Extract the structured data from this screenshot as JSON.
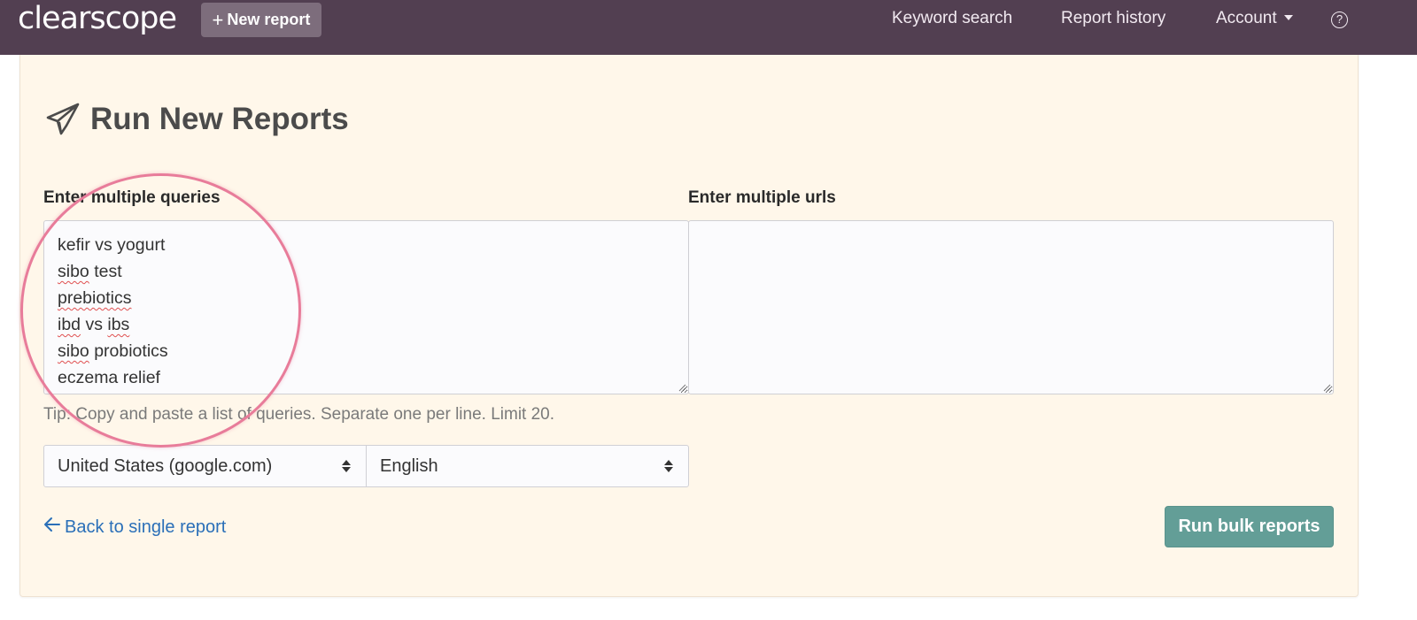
{
  "navbar": {
    "logo": "clearscope",
    "new_report_label": "New report",
    "links": {
      "keyword_search": "Keyword search",
      "report_history": "Report history",
      "account": "Account",
      "help_glyph": "?"
    }
  },
  "main": {
    "title": "Run New Reports",
    "title_icon": "paper-plane-icon",
    "queries_label": "Enter multiple queries",
    "urls_label": "Enter multiple urls",
    "queries": [
      {
        "words": [
          {
            "t": "kefir vs yogurt",
            "spell": false
          }
        ]
      },
      {
        "words": [
          {
            "t": "sibo",
            "spell": true
          },
          {
            "t": " test",
            "spell": false
          }
        ]
      },
      {
        "words": [
          {
            "t": "prebiotics",
            "spell": true
          }
        ]
      },
      {
        "words": [
          {
            "t": "ibd",
            "spell": true
          },
          {
            "t": " vs ",
            "spell": false
          },
          {
            "t": "ibs",
            "spell": true
          }
        ]
      },
      {
        "words": [
          {
            "t": "sibo",
            "spell": true
          },
          {
            "t": " probiotics",
            "spell": false
          }
        ]
      },
      {
        "words": [
          {
            "t": "eczema relief",
            "spell": false
          }
        ]
      }
    ],
    "urls_value": "",
    "tip": "Tip: Copy and paste a list of queries. Separate one per line. Limit 20.",
    "country_select": "United States (google.com)",
    "language_select": "English",
    "back_link": "Back to single report",
    "run_button": "Run bulk reports"
  },
  "colors": {
    "navbar_bg": "#523f51",
    "panel_bg": "#fff7ea",
    "primary_button": "#639e97",
    "link": "#2a6fb8",
    "highlight_circle": "#e87c9a"
  }
}
